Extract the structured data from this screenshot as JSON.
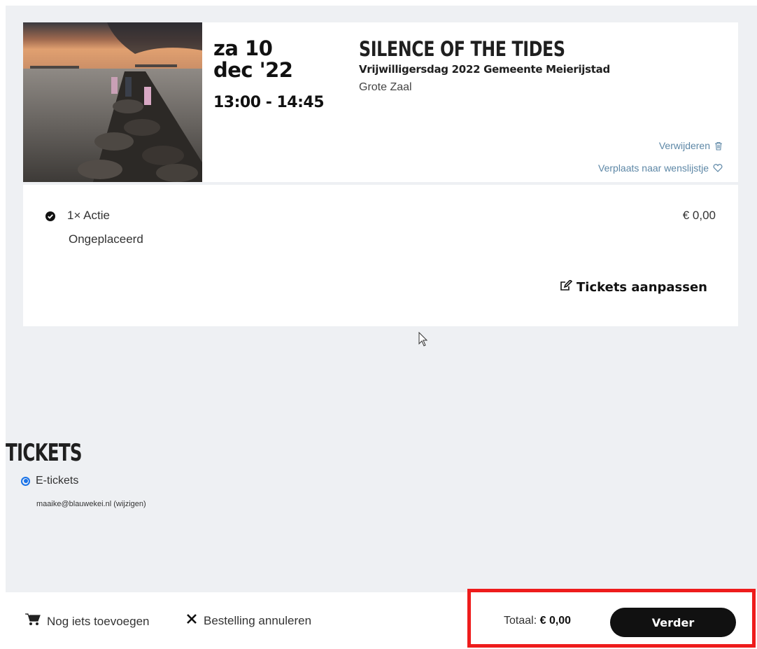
{
  "event": {
    "date_day": "za 10",
    "date_month": "dec '22",
    "time": "13:00 - 14:45",
    "title": "SILENCE OF THE TIDES",
    "subtitle": "Vrijwilligersdag 2022 Gemeente Meierijstad",
    "hall": "Grote Zaal",
    "image_icon": "event-photo"
  },
  "card_actions": {
    "remove_label": "Verwijderen",
    "remove_icon": "trash-icon",
    "wishlist_label": "Verplaats naar wenslijstje",
    "wishlist_icon": "heart-icon"
  },
  "ticket": {
    "quantity_label": "1× Actie",
    "price": "€ 0,00",
    "seat_status": "Ongeplaceerd",
    "edit_label": "Tickets aanpassen"
  },
  "tickets_section": {
    "heading": "TICKETS",
    "option_label": "E-tickets",
    "email_line": "maaike@blauwekei.nl (wijzigen)"
  },
  "footer": {
    "add_more_label": "Nog iets toevoegen",
    "cancel_label": "Bestelling annuleren",
    "total_label": "Totaal:",
    "total_value": "€ 0,00",
    "next_label": "Verder"
  },
  "colors": {
    "background": "#eef0f3",
    "link": "#5d87a6",
    "button": "#111111",
    "highlight": "#ee1c1c",
    "radio": "#1a73e8"
  }
}
